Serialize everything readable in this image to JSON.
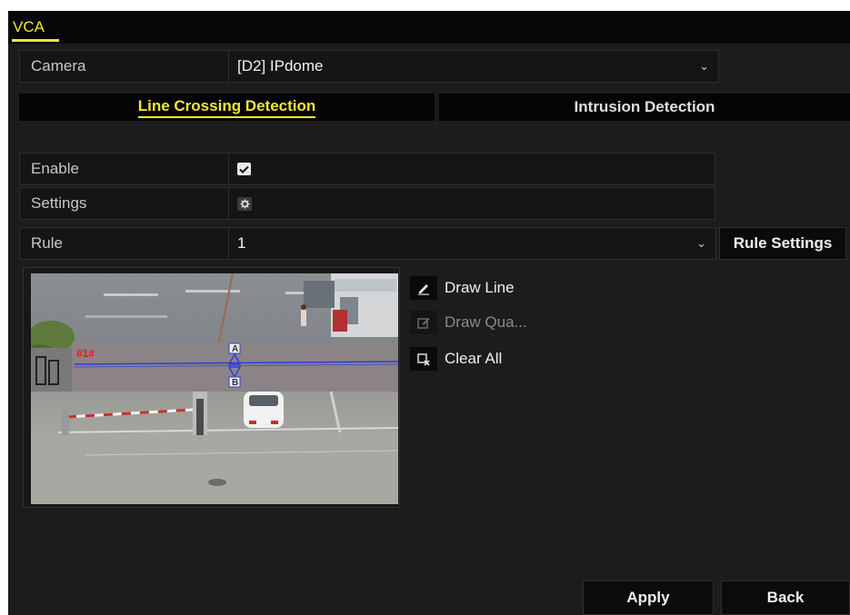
{
  "window": {
    "title": "VCA"
  },
  "camera": {
    "label": "Camera",
    "value": "[D2] IPdome"
  },
  "tabs": [
    {
      "label": "Line Crossing Detection",
      "active": true
    },
    {
      "label": "Intrusion Detection",
      "active": false
    }
  ],
  "enable": {
    "label": "Enable",
    "checked": true
  },
  "settings": {
    "label": "Settings"
  },
  "rule": {
    "label": "Rule",
    "value": "1",
    "button": "Rule Settings"
  },
  "video": {
    "rule_tag": "#1#",
    "side_a": "A",
    "side_b": "B"
  },
  "tools": [
    {
      "label": "Draw Line",
      "icon": "pencil-icon",
      "enabled": true
    },
    {
      "label": "Draw Qua...",
      "icon": "edit-icon",
      "enabled": false
    },
    {
      "label": "Clear All",
      "icon": "clear-icon",
      "enabled": true
    }
  ],
  "footer": {
    "apply": "Apply",
    "back": "Back"
  },
  "colors": {
    "accent": "#f2e634",
    "background": "#1c1c1c",
    "line": "#2f3fd8"
  }
}
